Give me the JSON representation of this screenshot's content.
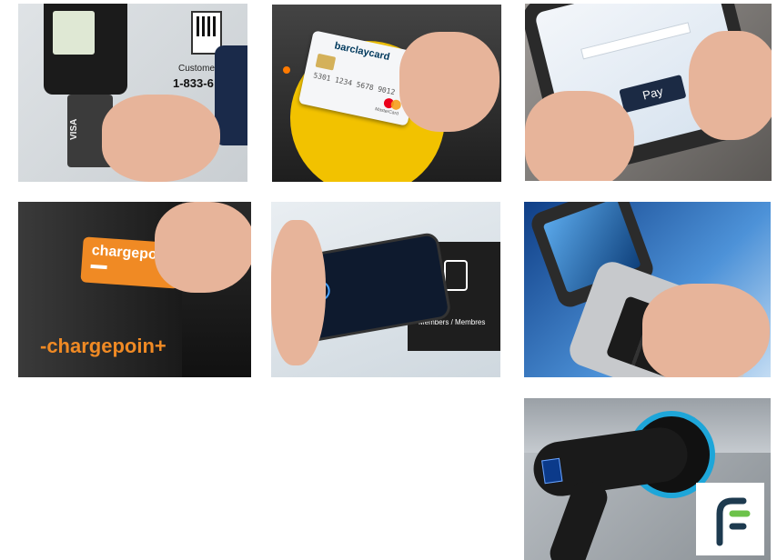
{
  "tiles": [
    {
      "name": "payment-terminal-card-insert-photo",
      "card_brand": "VISA",
      "sign_text": "Customer As",
      "sign_number": "1-833-6"
    },
    {
      "name": "contactless-card-tap-photo",
      "card_brand": "barclaycard",
      "card_number": "5301 1234 5678 9012",
      "card_network": "MasterCard"
    },
    {
      "name": "smartphone-pay-screen-photo",
      "button_label": "Pay"
    },
    {
      "name": "chargepoint-rfid-card-photo",
      "card_brand": "chargepoin",
      "station_brand": "-chargepoin+"
    },
    {
      "name": "phone-nfc-reader-photo",
      "reader_text": "Members / Membres"
    },
    {
      "name": "flip-phone-dialing-photo"
    },
    {
      "name": "ev-charging-connector-photo"
    }
  ],
  "colors": {
    "chargepoint_orange": "#f08a24",
    "logo_green": "#6cc24a",
    "logo_navy": "#1d3a4f",
    "pay_button": "#1b2a44"
  },
  "logo": {
    "icon": "chargepoint-style-logo-icon"
  }
}
